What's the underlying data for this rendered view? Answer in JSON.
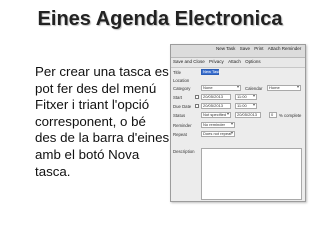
{
  "slide": {
    "title": "Eines Agenda Electronica",
    "body": "Per crear una tasca es pot fer des del menú Fitxer i triant l'opció corresponent, o bé des de la barra d'eines amb el botó Nova tasca."
  },
  "dialog": {
    "toolbar1": [
      "New Task",
      "Save",
      "Print",
      "Attach Reminder"
    ],
    "toolbar2": [
      "Save and Close",
      "Privacy",
      "Attach",
      "Options"
    ],
    "fields": {
      "title_label": "Title",
      "title_value": "New Task",
      "location_label": "Location",
      "category_label": "Category",
      "category_value": "None",
      "calendar_label": "Calendar",
      "calendar_value": "Home",
      "start_label": "Start",
      "start_date": "20/05/2013",
      "start_time": "11:00",
      "due_label": "Due Date",
      "due_date": "20/05/2013",
      "due_time": "11:00",
      "status_label": "Status",
      "status_value": "Not specified",
      "status_date": "20/05/2013",
      "complete_label": "% complete",
      "complete_value": "0",
      "reminder_label": "Reminder",
      "reminder_value": "No reminder",
      "repeat_label": "Repeat",
      "repeat_value": "Does not repeat",
      "description_label": "Description"
    }
  }
}
